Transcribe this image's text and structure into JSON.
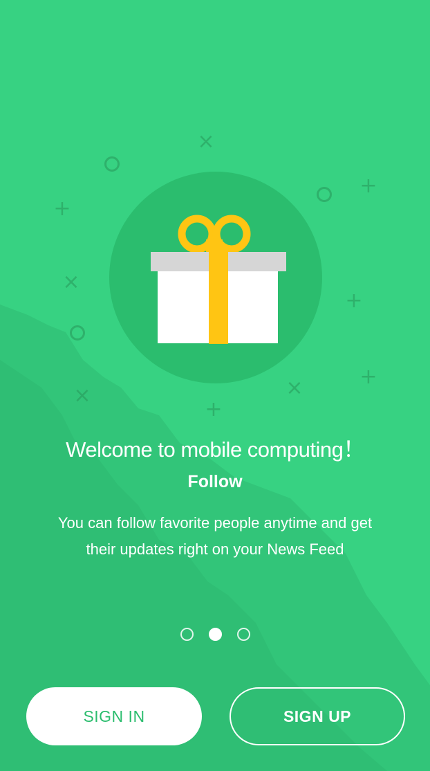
{
  "onboarding": {
    "title": "Welcome to mobile computing！",
    "subtitle": "Follow",
    "description": "You can follow favorite people anytime and get their updates right on your News Feed",
    "illustration_icon": "gift-icon",
    "pagination": {
      "total": 3,
      "active_index": 1
    }
  },
  "buttons": {
    "sign_in": "SIGN IN",
    "sign_up": "SIGN UP"
  },
  "colors": {
    "background": "#37d282",
    "accent": "#2bbd6e",
    "ribbon": "#ffc513",
    "box": "#ffffff",
    "lid": "#d6d6d6"
  }
}
